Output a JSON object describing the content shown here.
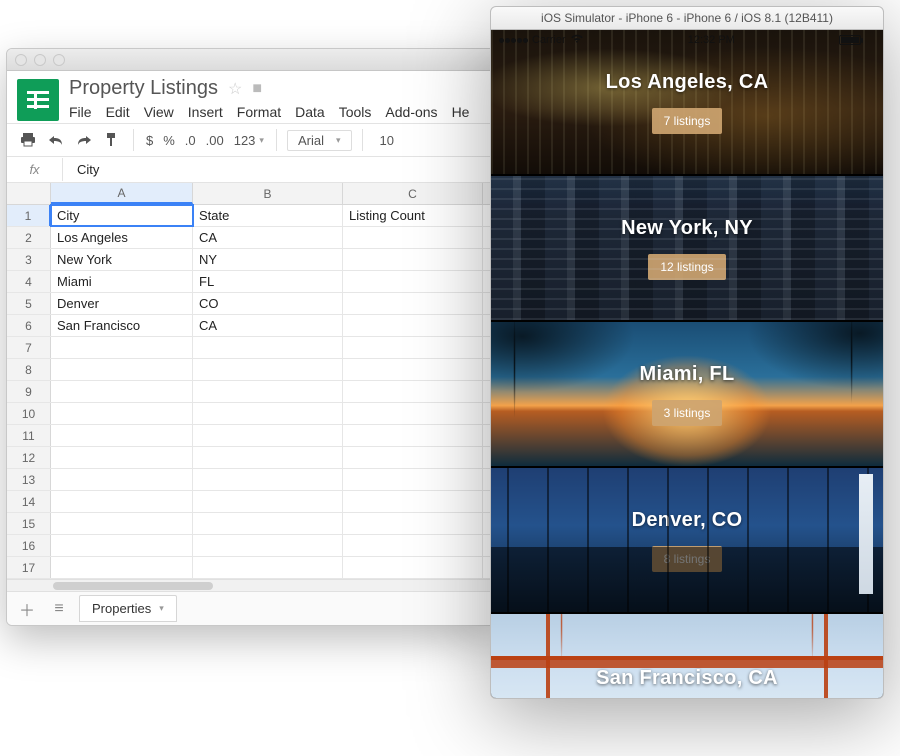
{
  "sheets": {
    "doc_title": "Property Listings",
    "menus": [
      "File",
      "Edit",
      "View",
      "Insert",
      "Format",
      "Data",
      "Tools",
      "Add-ons",
      "He"
    ],
    "toolbar": {
      "currency": "$",
      "percent": "%",
      "dec_dec": ".0",
      "inc_dec": ".00",
      "num_format": "123",
      "font_name": "Arial",
      "font_size": "10"
    },
    "formula": {
      "fx": "fx",
      "value": "City"
    },
    "columns": [
      "A",
      "B",
      "C"
    ],
    "headers": [
      "City",
      "State",
      "Listing Count"
    ],
    "rows": [
      {
        "num": 1,
        "city": "City",
        "state": "State",
        "count": "Listing Count"
      },
      {
        "num": 2,
        "city": "Los Angeles",
        "state": "CA",
        "count": ""
      },
      {
        "num": 3,
        "city": "New York",
        "state": "NY",
        "count": ""
      },
      {
        "num": 4,
        "city": "Miami",
        "state": "FL",
        "count": ""
      },
      {
        "num": 5,
        "city": "Denver",
        "state": "CO",
        "count": ""
      },
      {
        "num": 6,
        "city": "San Francisco",
        "state": "CA",
        "count": ""
      },
      {
        "num": 7,
        "city": "",
        "state": "",
        "count": ""
      },
      {
        "num": 8,
        "city": "",
        "state": "",
        "count": ""
      },
      {
        "num": 9,
        "city": "",
        "state": "",
        "count": ""
      },
      {
        "num": 10,
        "city": "",
        "state": "",
        "count": ""
      },
      {
        "num": 11,
        "city": "",
        "state": "",
        "count": ""
      },
      {
        "num": 12,
        "city": "",
        "state": "",
        "count": ""
      },
      {
        "num": 13,
        "city": "",
        "state": "",
        "count": ""
      },
      {
        "num": 14,
        "city": "",
        "state": "",
        "count": ""
      },
      {
        "num": 15,
        "city": "",
        "state": "",
        "count": ""
      },
      {
        "num": 16,
        "city": "",
        "state": "",
        "count": ""
      },
      {
        "num": 17,
        "city": "",
        "state": "",
        "count": ""
      }
    ],
    "tab_label": "Properties"
  },
  "simulator": {
    "title": "iOS Simulator - iPhone 6 - iPhone 6 / iOS 8.1 (12B411)",
    "status": {
      "carrier": "Carrier",
      "time": "12:32 PM"
    },
    "cards": [
      {
        "title": "Los Angeles, CA",
        "badge": "7 listings",
        "bg": "bg-la"
      },
      {
        "title": "New York, NY",
        "badge": "12 listings",
        "bg": "bg-ny"
      },
      {
        "title": "Miami, FL",
        "badge": "3 listings",
        "bg": "bg-mi"
      },
      {
        "title": "Denver, CO",
        "badge": "8 listings",
        "bg": "bg-dv"
      },
      {
        "title": "San Francisco, CA",
        "badge": "",
        "bg": "bg-sf"
      }
    ]
  }
}
